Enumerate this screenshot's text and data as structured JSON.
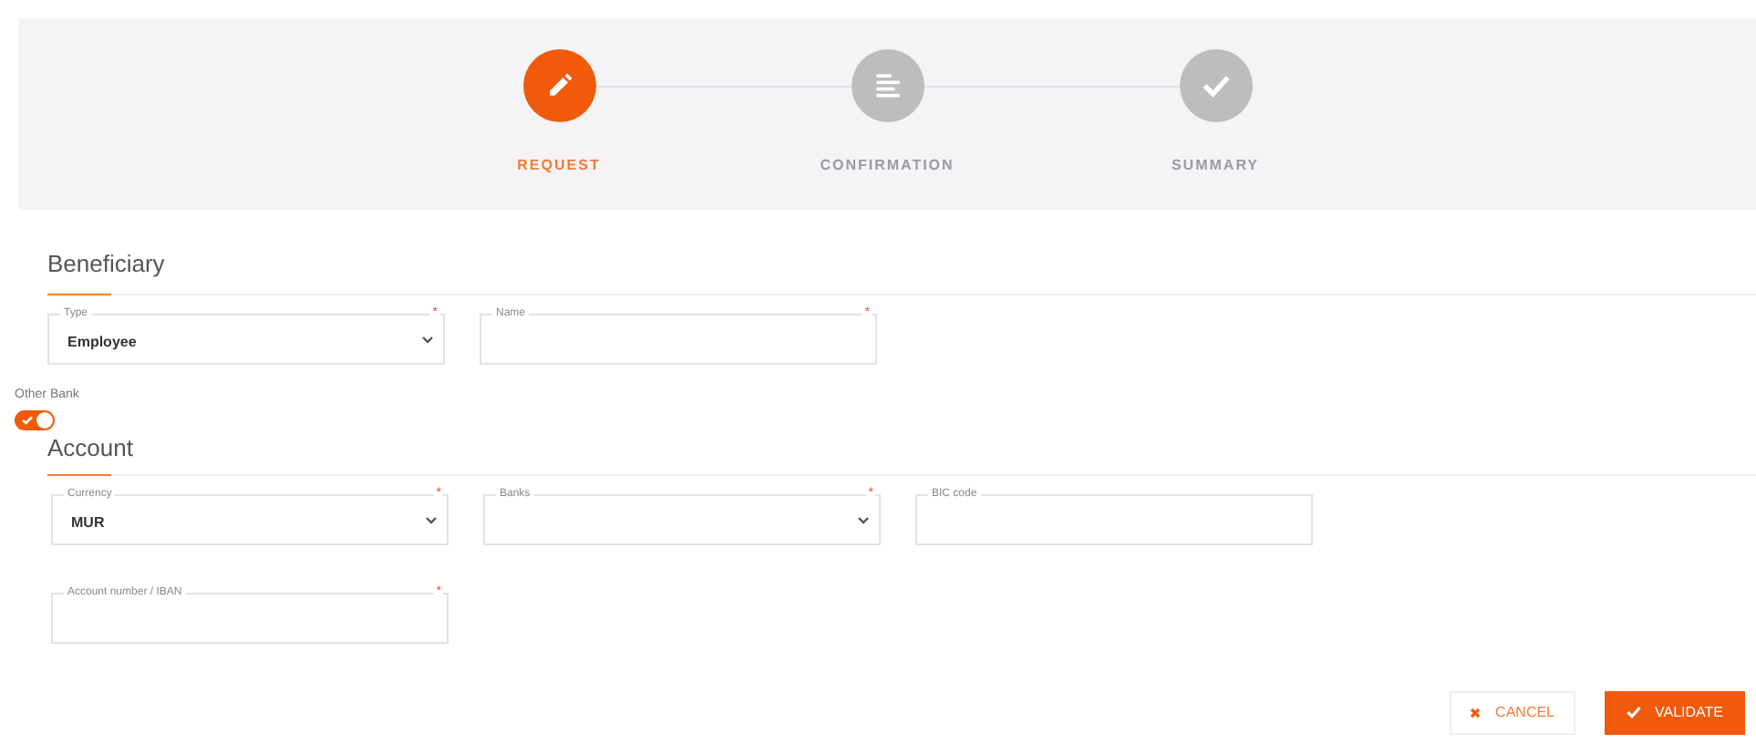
{
  "steps": [
    {
      "label": "REQUEST",
      "selected": true
    },
    {
      "label": "CONFIRMATION",
      "selected": false
    },
    {
      "label": "SUMMARY",
      "selected": false
    }
  ],
  "sections": [
    {
      "title": "Beneficiary",
      "rows": [
        [
          {
            "kind": "select",
            "label": "Type",
            "value": "Employee",
            "required_mark": "*"
          },
          {
            "kind": "text",
            "label": "Name",
            "required_mark": "*"
          }
        ]
      ]
    },
    {
      "toggle": {
        "label": "Other Bank",
        "on": true
      },
      "title": "Account",
      "rows": [
        [
          {
            "kind": "select",
            "label": "Currency",
            "value": "MUR",
            "required_mark": "*"
          },
          {
            "kind": "select",
            "label": "Banks",
            "required_mark": "*"
          },
          {
            "kind": "text",
            "label": "BIC code"
          }
        ],
        [
          {
            "kind": "text",
            "label": "Account number / IBAN",
            "required_mark": "*"
          }
        ]
      ]
    }
  ],
  "buttons": [
    {
      "kind": "cancel",
      "label": "CANCEL"
    },
    {
      "kind": "primary",
      "label": "VALIDATE"
    }
  ]
}
